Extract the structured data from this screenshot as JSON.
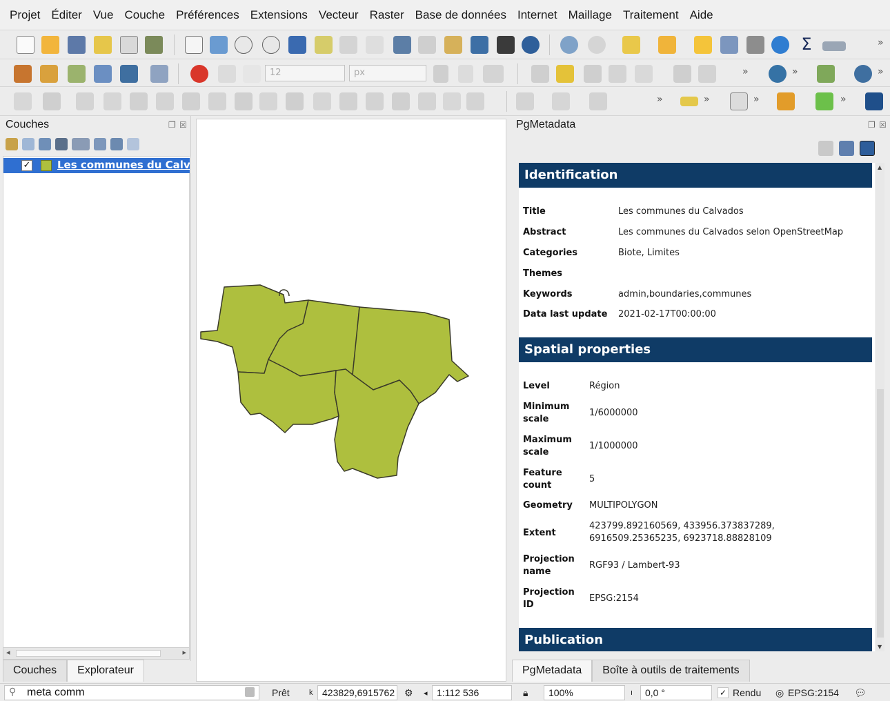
{
  "menu": [
    "Projet",
    "Éditer",
    "Vue",
    "Couche",
    "Préférences",
    "Extensions",
    "Vecteur",
    "Raster",
    "Base de données",
    "Internet",
    "Maillage",
    "Traitement",
    "Aide"
  ],
  "toolbar": {
    "font_size_value": "12",
    "font_unit_value": "px",
    "more_chevron": "»"
  },
  "layers_panel": {
    "title": "Couches",
    "layer_name": "Les communes du Calvados",
    "layer_visible": true,
    "tabs": [
      "Couches",
      "Explorateur"
    ]
  },
  "metadata_panel": {
    "title": "PgMetadata",
    "tabs": [
      "PgMetadata",
      "Boîte à outils de traitements"
    ],
    "identification": {
      "heading": "Identification",
      "rows": [
        {
          "key": "Title",
          "value": "Les communes du Calvados"
        },
        {
          "key": "Abstract",
          "value": "Les communes du Calvados selon OpenStreetMap"
        },
        {
          "key": "Categories",
          "value": "Biote, Limites"
        },
        {
          "key": "Themes",
          "value": ""
        },
        {
          "key": "Keywords",
          "value": "admin,boundaries,communes"
        },
        {
          "key": "Data last update",
          "value": "2021-02-17T00:00:00"
        }
      ]
    },
    "spatial": {
      "heading": "Spatial properties",
      "rows": [
        {
          "key": "Level",
          "value": "Région"
        },
        {
          "key": "Minimum scale",
          "value": "1/6000000"
        },
        {
          "key": "Maximum scale",
          "value": "1/1000000"
        },
        {
          "key": "Feature count",
          "value": "5"
        },
        {
          "key": "Geometry",
          "value": "MULTIPOLYGON"
        },
        {
          "key": "Extent",
          "value": "423799.892160569, 433956.373837289, 6916509.25365235, 6923718.88828109"
        },
        {
          "key": "Projection name",
          "value": "RGF93 / Lambert-93"
        },
        {
          "key": "Projection ID",
          "value": "EPSG:2154"
        }
      ]
    },
    "publication": {
      "heading": "Publication"
    }
  },
  "status": {
    "search_value": "meta comm",
    "ready": "Prêt",
    "coordinates": "423829,6915762",
    "scale": "1:112 536",
    "magnifier": "100%",
    "rotation": "0,0 °",
    "render_label": "Rendu",
    "render_checked": true,
    "crs": "EPSG:2154"
  },
  "colors": {
    "polygon_fill": "#aebf3e",
    "polygon_stroke": "#3a3a2a",
    "section_header": "#0f3b66",
    "selection": "#2f6fd1"
  }
}
